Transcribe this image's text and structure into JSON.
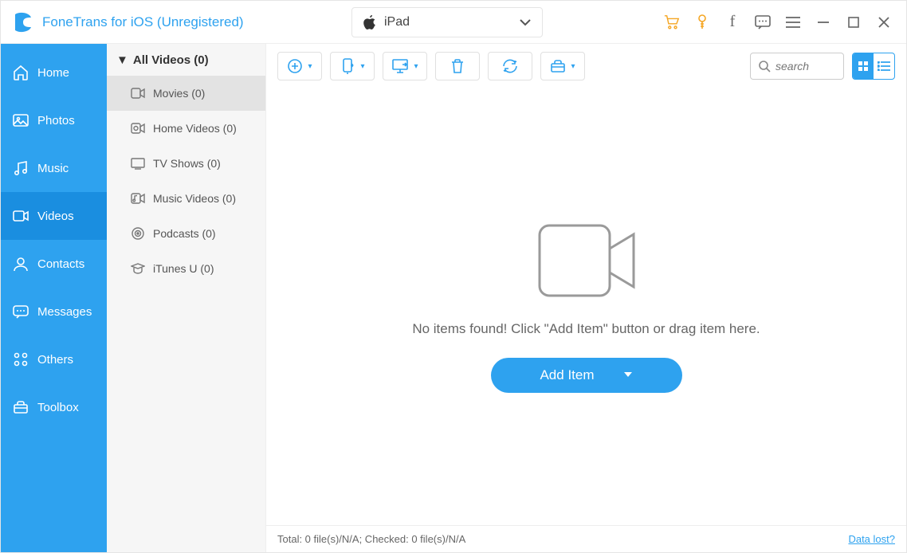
{
  "header": {
    "app_title": "FoneTrans for iOS (Unregistered)",
    "device_name": "iPad"
  },
  "sidebar": [
    {
      "label": "Home",
      "icon": "home"
    },
    {
      "label": "Photos",
      "icon": "photos"
    },
    {
      "label": "Music",
      "icon": "music"
    },
    {
      "label": "Videos",
      "icon": "videos",
      "active": true
    },
    {
      "label": "Contacts",
      "icon": "contacts"
    },
    {
      "label": "Messages",
      "icon": "messages"
    },
    {
      "label": "Others",
      "icon": "others"
    },
    {
      "label": "Toolbox",
      "icon": "toolbox"
    }
  ],
  "sub": {
    "header": "All Videos (0)",
    "items": [
      {
        "label": "Movies (0)",
        "icon": "movie",
        "active": true
      },
      {
        "label": "Home Videos (0)",
        "icon": "homevideo"
      },
      {
        "label": "TV Shows (0)",
        "icon": "tv"
      },
      {
        "label": "Music Videos (0)",
        "icon": "musicvideo"
      },
      {
        "label": "Podcasts (0)",
        "icon": "podcast"
      },
      {
        "label": "iTunes U (0)",
        "icon": "itunesu"
      }
    ]
  },
  "search": {
    "placeholder": "search"
  },
  "empty": {
    "message": "No items found! Click \"Add Item\" button or drag item here.",
    "button": "Add Item"
  },
  "status": {
    "text": "Total: 0 file(s)/N/A; Checked: 0 file(s)/N/A",
    "link": "Data lost?"
  }
}
